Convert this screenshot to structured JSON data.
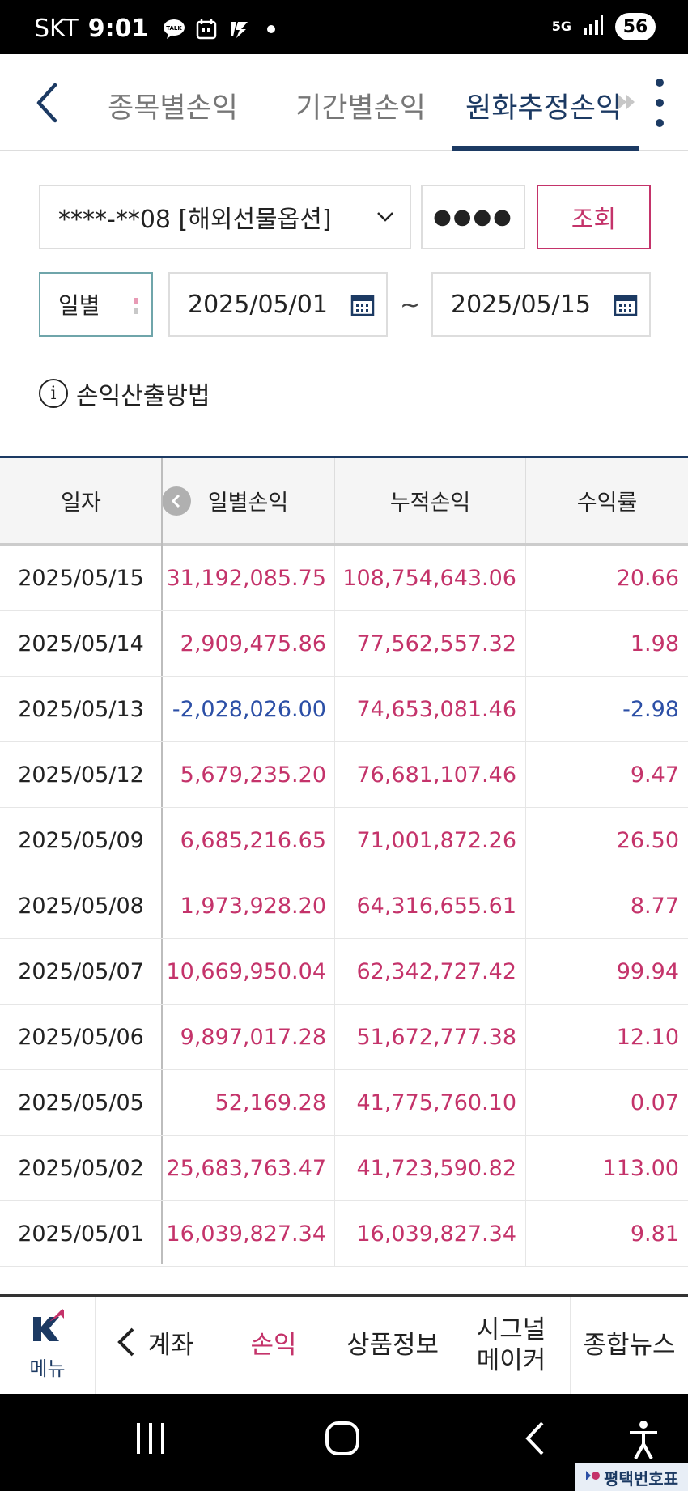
{
  "status_bar": {
    "carrier": "SKT",
    "time": "9:01",
    "network": "5G",
    "battery": "56",
    "icons": [
      "talk-icon",
      "calendar-icon",
      "app-icon",
      "dot-icon"
    ]
  },
  "header": {
    "tabs": [
      {
        "label": "종목별손익",
        "active": false
      },
      {
        "label": "기간별손익",
        "active": false
      },
      {
        "label": "원화추정손익",
        "active": true
      }
    ],
    "active_color": "#1c3a63"
  },
  "form": {
    "account": "****-**08 [해외선물옵션]",
    "password_mask": "●●●●",
    "query_label": "조회",
    "period": "일별",
    "date_from": "2025/05/01",
    "tilde": "~",
    "date_to": "2025/05/15",
    "info_label": "손익산출방법"
  },
  "table": {
    "headers": [
      "일자",
      "일별손익",
      "누적손익",
      "수익률"
    ],
    "rows": [
      {
        "date": "2025/05/15",
        "daily": "31,192,085.75",
        "cum": "108,754,643.06",
        "rate": "20.66",
        "sign": "pos"
      },
      {
        "date": "2025/05/14",
        "daily": "2,909,475.86",
        "cum": "77,562,557.32",
        "rate": "1.98",
        "sign": "pos"
      },
      {
        "date": "2025/05/13",
        "daily": "-2,028,026.00",
        "cum": "74,653,081.46",
        "rate": "-2.98",
        "sign": "neg"
      },
      {
        "date": "2025/05/12",
        "daily": "5,679,235.20",
        "cum": "76,681,107.46",
        "rate": "9.47",
        "sign": "pos"
      },
      {
        "date": "2025/05/09",
        "daily": "6,685,216.65",
        "cum": "71,001,872.26",
        "rate": "26.50",
        "sign": "pos"
      },
      {
        "date": "2025/05/08",
        "daily": "1,973,928.20",
        "cum": "64,316,655.61",
        "rate": "8.77",
        "sign": "pos"
      },
      {
        "date": "2025/05/07",
        "daily": "10,669,950.04",
        "cum": "62,342,727.42",
        "rate": "99.94",
        "sign": "pos"
      },
      {
        "date": "2025/05/06",
        "daily": "9,897,017.28",
        "cum": "51,672,777.38",
        "rate": "12.10",
        "sign": "pos"
      },
      {
        "date": "2025/05/05",
        "daily": "52,169.28",
        "cum": "41,775,760.10",
        "rate": "0.07",
        "sign": "pos"
      },
      {
        "date": "2025/05/02",
        "daily": "25,683,763.47",
        "cum": "41,723,590.82",
        "rate": "113.00",
        "sign": "pos"
      },
      {
        "date": "2025/05/01",
        "daily": "16,039,827.34",
        "cum": "16,039,827.34",
        "rate": "9.81",
        "sign": "pos"
      }
    ],
    "colors": {
      "positive": "#c4336a",
      "negative": "#2c4fa6"
    }
  },
  "bottom_nav": {
    "menu_logo": "K",
    "menu_label": "메뉴",
    "items": [
      "계좌",
      "손익",
      "상품정보",
      "시그널\n메이커",
      "종합뉴스"
    ],
    "active_index": 1
  },
  "watermark": {
    "text": "평택번호표"
  }
}
